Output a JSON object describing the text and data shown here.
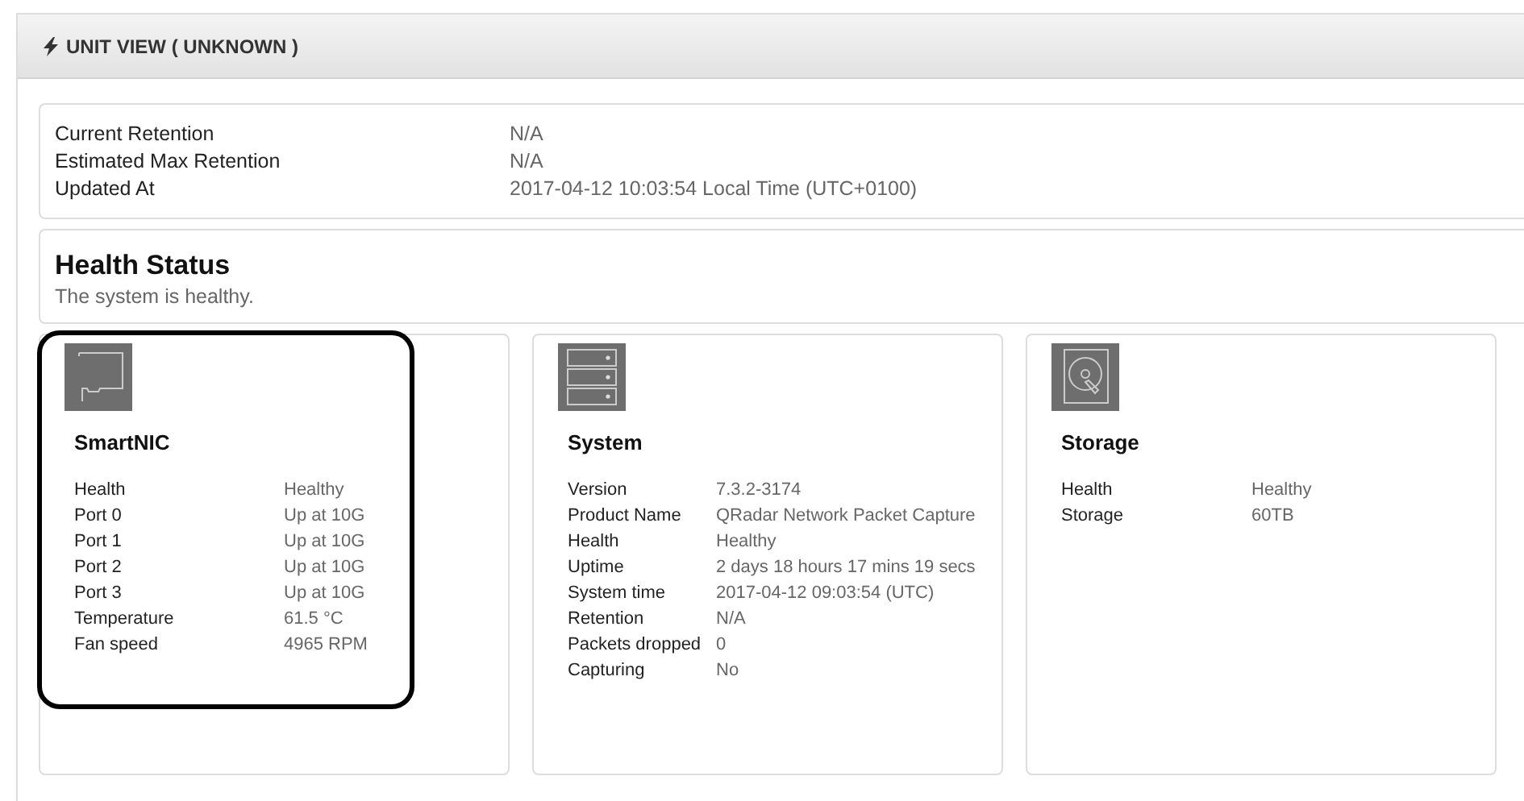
{
  "panel": {
    "title": "UNIT VIEW ( UNKNOWN )"
  },
  "summary": [
    {
      "label": "Current Retention",
      "value": "N/A"
    },
    {
      "label": "Estimated Max Retention",
      "value": "N/A"
    },
    {
      "label": "Updated At",
      "value": "2017-04-12 10:03:54 Local Time (UTC+0100)"
    }
  ],
  "health": {
    "title": "Health Status",
    "message": "The system is healthy."
  },
  "cards": [
    {
      "kind": "nic",
      "title": "SmartNIC",
      "highlighted": true,
      "rows": [
        {
          "label": "Health",
          "value": "Healthy"
        },
        {
          "label": "Port 0",
          "value": "Up at 10G"
        },
        {
          "label": "Port 1",
          "value": "Up at 10G"
        },
        {
          "label": "Port 2",
          "value": "Up at 10G"
        },
        {
          "label": "Port 3",
          "value": "Up at 10G"
        },
        {
          "label": "Temperature",
          "value": "61.5 °C"
        },
        {
          "label": "Fan speed",
          "value": "4965 RPM"
        }
      ]
    },
    {
      "kind": "server",
      "title": "System",
      "highlighted": false,
      "rows": [
        {
          "label": "Version",
          "value": "7.3.2-3174"
        },
        {
          "label": "Product Name",
          "value": "QRadar Network Packet Capture"
        },
        {
          "label": "Health",
          "value": "Healthy"
        },
        {
          "label": "Uptime",
          "value": "2 days 18 hours 17 mins 19 secs"
        },
        {
          "label": "System time",
          "value": "2017-04-12 09:03:54 (UTC)"
        },
        {
          "label": "Retention",
          "value": "N/A"
        },
        {
          "label": "Packets dropped",
          "value": "0"
        },
        {
          "label": "Capturing",
          "value": "No"
        }
      ]
    },
    {
      "kind": "disk",
      "title": "Storage",
      "highlighted": false,
      "rows": [
        {
          "label": "Health",
          "value": "Healthy"
        },
        {
          "label": "Storage",
          "value": "60TB"
        }
      ]
    }
  ]
}
